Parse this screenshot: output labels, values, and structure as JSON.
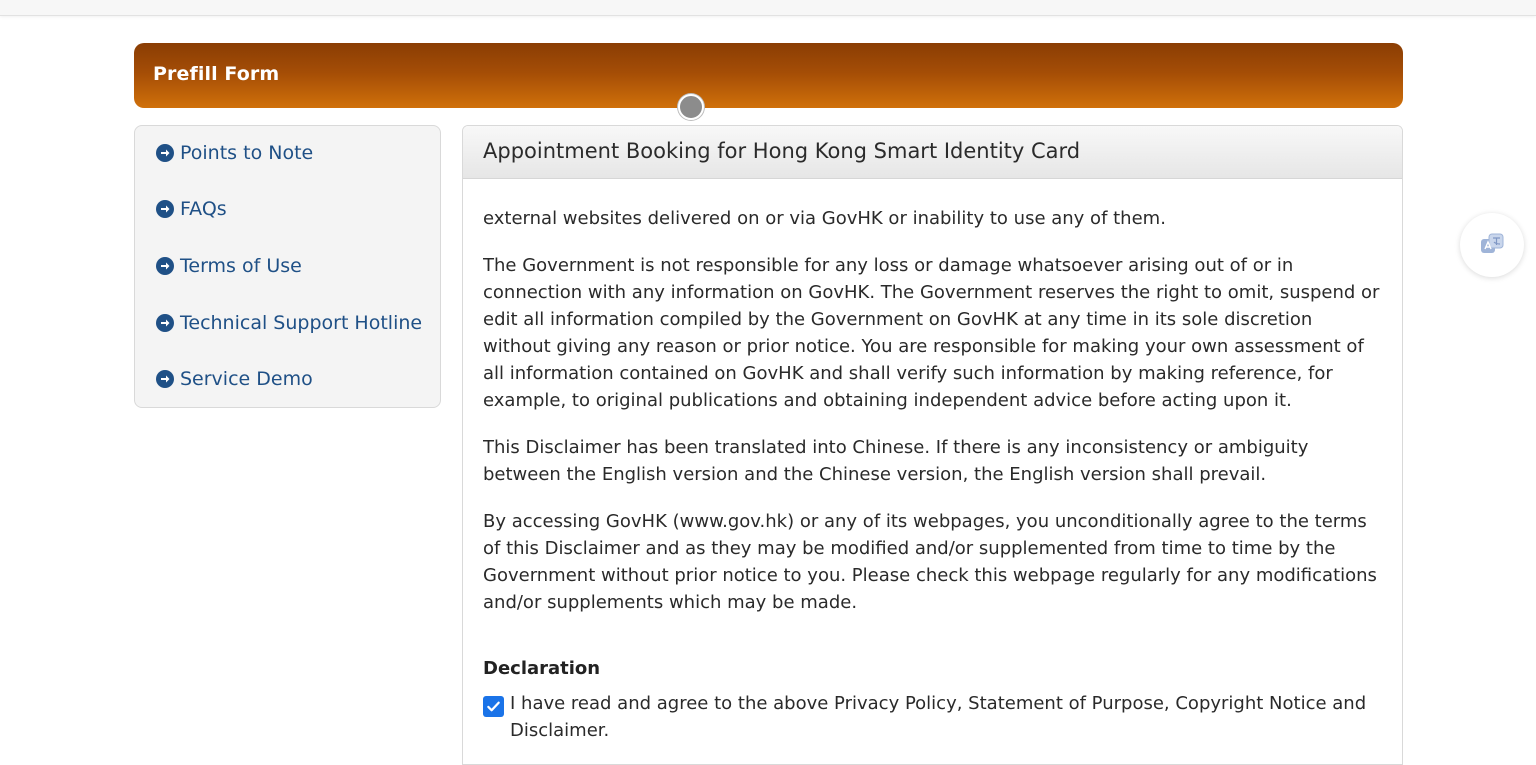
{
  "banner": {
    "title": "Prefill Form"
  },
  "sidebar": {
    "items": [
      {
        "label": "Points to Note",
        "icon": "arrow-right-circle-icon"
      },
      {
        "label": "FAQs",
        "icon": "arrow-right-circle-icon"
      },
      {
        "label": "Terms of Use",
        "icon": "arrow-right-circle-icon"
      },
      {
        "label": "Technical Support Hotline",
        "icon": "arrow-right-circle-icon"
      },
      {
        "label": "Service Demo",
        "icon": "arrow-right-circle-icon"
      }
    ]
  },
  "panel": {
    "title": "Appointment Booking for Hong Kong Smart Identity Card",
    "clipped_line": "external websites delivered on or via GovHK or inability to use any of them.",
    "paragraphs": [
      "The Government is not responsible for any loss or damage whatsoever arising out of or in connection with any information on GovHK. The Government reserves the right to omit, suspend or edit all information compiled by the Government on GovHK at any time in its sole discretion without giving any reason or prior notice. You are responsible for making your own assessment of all information contained on GovHK and shall verify such information by making reference, for example, to original publications and obtaining independent advice before acting upon it.",
      "This Disclaimer has been translated into Chinese. If there is any inconsistency or ambiguity between the English version and the Chinese version, the English version shall prevail.",
      "By accessing GovHK (www.gov.hk) or any of its webpages, you unconditionally agree to the terms of this Disclaimer and as they may be modified and/or supplemented from time to time by the Government without prior notice to you. Please check this webpage regularly for any modifications and/or supplements which may be made."
    ],
    "declaration_heading": "Declaration",
    "declaration_text": "I have read and agree to the above Privacy Policy, Statement of Purpose, Copyright Notice and Disclaimer.",
    "declaration_checked": true
  },
  "floating_button": {
    "icon": "translate-icon"
  },
  "colors": {
    "banner_dark": "#8a3d04",
    "banner_light": "#d0700a",
    "link_blue": "#1f5086",
    "checkbox_blue": "#1a73e8"
  }
}
